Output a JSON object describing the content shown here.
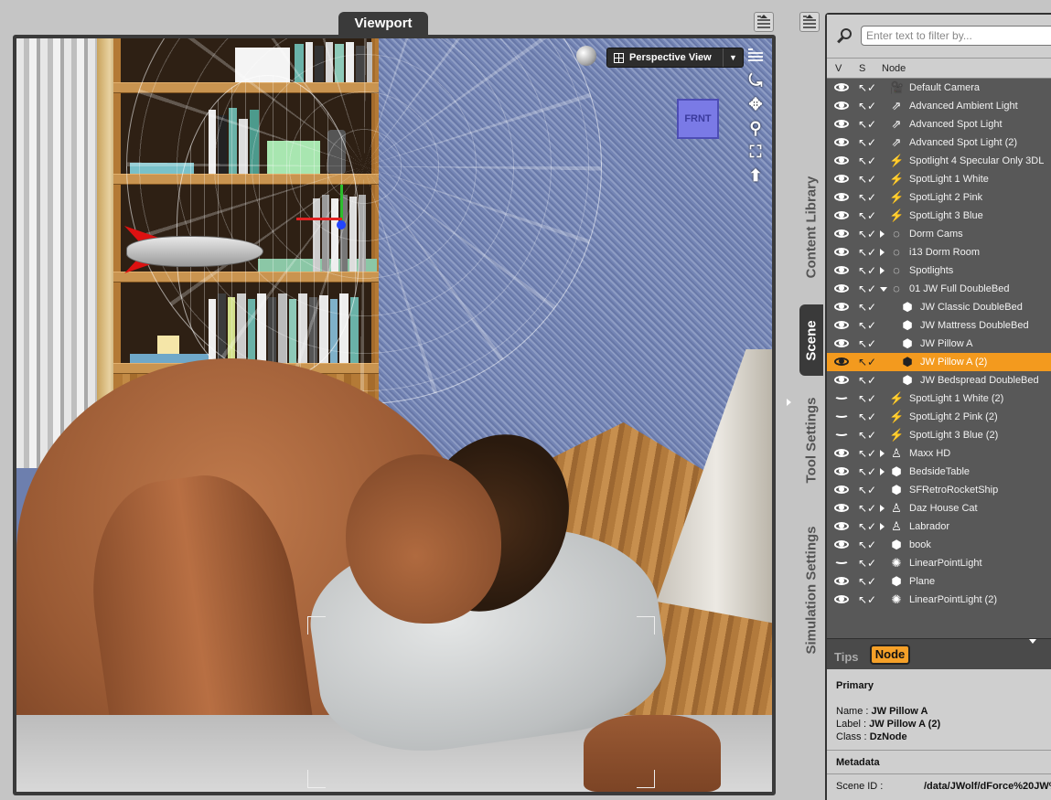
{
  "viewport": {
    "tab_label": "Viewport",
    "view_selector": "Perspective View",
    "view_dropdown_glyph": "▼",
    "aux_cube_label": "FRNT",
    "tools": [
      "⤿",
      "✥",
      "⚲",
      "⛶",
      "⬆"
    ]
  },
  "rail": {
    "tabs": [
      {
        "label": "Content Library",
        "active": false
      },
      {
        "label": "Scene",
        "active": true
      },
      {
        "label": "Tool Settings",
        "active": false
      },
      {
        "label": "Simulation Settings",
        "active": false
      }
    ]
  },
  "scene_pane": {
    "filter_placeholder": "Enter text to filter by...",
    "columns": {
      "visible": "V",
      "selectable": "S",
      "node": "Node"
    },
    "nodes": [
      {
        "label": "Default Camera",
        "icon": "camera-icon",
        "glyph": "🎥",
        "indent": 0,
        "twisty": "none",
        "visible": true,
        "selected": false
      },
      {
        "label": "Advanced Ambient Light",
        "icon": "distant-light-icon",
        "glyph": "⇗",
        "indent": 0,
        "twisty": "none",
        "visible": true,
        "selected": false
      },
      {
        "label": "Advanced Spot Light",
        "icon": "distant-light-icon",
        "glyph": "⇗",
        "indent": 0,
        "twisty": "none",
        "visible": true,
        "selected": false
      },
      {
        "label": "Advanced Spot Light (2)",
        "icon": "distant-light-icon",
        "glyph": "⇗",
        "indent": 0,
        "twisty": "none",
        "visible": true,
        "selected": false
      },
      {
        "label": "Spotlight 4 Specular Only 3DL",
        "icon": "spotlight-icon",
        "glyph": "⚡",
        "indent": 0,
        "twisty": "none",
        "visible": true,
        "selected": false
      },
      {
        "label": "SpotLight 1 White",
        "icon": "spotlight-icon",
        "glyph": "⚡",
        "indent": 0,
        "twisty": "none",
        "visible": true,
        "selected": false
      },
      {
        "label": "SpotLight 2 Pink",
        "icon": "spotlight-icon",
        "glyph": "⚡",
        "indent": 0,
        "twisty": "none",
        "visible": true,
        "selected": false
      },
      {
        "label": "SpotLight 3 Blue",
        "icon": "spotlight-icon",
        "glyph": "⚡",
        "indent": 0,
        "twisty": "none",
        "visible": true,
        "selected": false
      },
      {
        "label": "Dorm Cams",
        "icon": "group-icon",
        "glyph": "◌",
        "indent": 0,
        "twisty": "closed",
        "visible": true,
        "selected": false
      },
      {
        "label": "i13 Dorm Room",
        "icon": "group-icon",
        "glyph": "◌",
        "indent": 0,
        "twisty": "closed",
        "visible": true,
        "selected": false
      },
      {
        "label": "Spotlights",
        "icon": "group-icon",
        "glyph": "◌",
        "indent": 0,
        "twisty": "closed",
        "visible": true,
        "selected": false
      },
      {
        "label": "01 JW Full DoubleBed",
        "icon": "group-icon",
        "glyph": "◌",
        "indent": 0,
        "twisty": "open",
        "visible": true,
        "selected": false
      },
      {
        "label": "JW Classic DoubleBed",
        "icon": "prop-icon",
        "glyph": "⬢",
        "indent": 1,
        "twisty": "none",
        "visible": true,
        "selected": false
      },
      {
        "label": "JW Mattress DoubleBed",
        "icon": "prop-icon",
        "glyph": "⬢",
        "indent": 1,
        "twisty": "none",
        "visible": true,
        "selected": false
      },
      {
        "label": "JW Pillow A",
        "icon": "prop-icon",
        "glyph": "⬢",
        "indent": 1,
        "twisty": "none",
        "visible": true,
        "selected": false
      },
      {
        "label": "JW Pillow A (2)",
        "icon": "prop-icon",
        "glyph": "⬢",
        "indent": 1,
        "twisty": "none",
        "visible": true,
        "selected": true
      },
      {
        "label": "JW Bedspread DoubleBed",
        "icon": "prop-icon",
        "glyph": "⬢",
        "indent": 1,
        "twisty": "none",
        "visible": true,
        "selected": false
      },
      {
        "label": "SpotLight 1 White (2)",
        "icon": "spotlight-icon",
        "glyph": "⚡",
        "indent": 0,
        "twisty": "none",
        "visible": false,
        "selected": false
      },
      {
        "label": "SpotLight 2 Pink (2)",
        "icon": "spotlight-icon",
        "glyph": "⚡",
        "indent": 0,
        "twisty": "none",
        "visible": false,
        "selected": false
      },
      {
        "label": "SpotLight 3 Blue (2)",
        "icon": "spotlight-icon",
        "glyph": "⚡",
        "indent": 0,
        "twisty": "none",
        "visible": false,
        "selected": false
      },
      {
        "label": "Maxx HD",
        "icon": "figure-icon",
        "glyph": "♙",
        "indent": 0,
        "twisty": "closed",
        "visible": true,
        "selected": false
      },
      {
        "label": "BedsideTable",
        "icon": "prop-icon",
        "glyph": "⬢",
        "indent": 0,
        "twisty": "closed",
        "visible": true,
        "selected": false
      },
      {
        "label": "SFRetroRocketShip",
        "icon": "prop-icon",
        "glyph": "⬢",
        "indent": 0,
        "twisty": "none",
        "visible": true,
        "selected": false
      },
      {
        "label": "Daz House Cat",
        "icon": "figure-icon",
        "glyph": "♙",
        "indent": 0,
        "twisty": "closed",
        "visible": true,
        "selected": false
      },
      {
        "label": "Labrador",
        "icon": "figure-icon",
        "glyph": "♙",
        "indent": 0,
        "twisty": "closed",
        "visible": true,
        "selected": false
      },
      {
        "label": "book",
        "icon": "prop-icon",
        "glyph": "⬢",
        "indent": 0,
        "twisty": "none",
        "visible": true,
        "selected": false
      },
      {
        "label": "LinearPointLight",
        "icon": "point-light-icon",
        "glyph": "✺",
        "indent": 0,
        "twisty": "none",
        "visible": false,
        "selected": false
      },
      {
        "label": "Plane",
        "icon": "prop-icon",
        "glyph": "⬢",
        "indent": 0,
        "twisty": "none",
        "visible": true,
        "selected": false
      },
      {
        "label": "LinearPointLight (2)",
        "icon": "point-light-icon",
        "glyph": "✺",
        "indent": 0,
        "twisty": "none",
        "visible": true,
        "selected": false
      }
    ]
  },
  "tips": {
    "tab_tips": "Tips",
    "tab_node": "Node",
    "primary_heading": "Primary",
    "name_label": "Name : ",
    "name_value": "JW Pillow A",
    "label_label": "Label : ",
    "label_value": "JW Pillow A (2)",
    "class_label": "Class : ",
    "class_value": "DzNode",
    "metadata_heading": "Metadata",
    "scene_id_label": "Scene ID :",
    "scene_id_value": "/data/JWolf/dForce%20JW%"
  },
  "colors": {
    "selection": "#f39a1e",
    "panel_dark": "#585858",
    "tab_dark": "#3a3a3a",
    "chrome": "#c5c5c5"
  }
}
